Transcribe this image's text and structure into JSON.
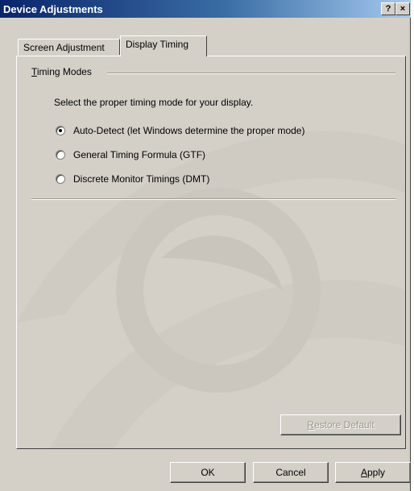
{
  "window": {
    "title": "Device Adjustments",
    "help_glyph": "?",
    "close_glyph": "×"
  },
  "tabs": [
    {
      "label": "Screen Adjustment",
      "active": false
    },
    {
      "label": "Display Timing",
      "active": true
    }
  ],
  "timing_group": {
    "label_mnemonic": "T",
    "label_rest": "iming Modes",
    "instruction": "Select the proper timing mode for your display.",
    "options": [
      {
        "label": "Auto-Detect (let Windows determine the proper mode)",
        "selected": true
      },
      {
        "label": "General Timing Formula (GTF)",
        "selected": false
      },
      {
        "label": "Discrete Monitor Timings (DMT)",
        "selected": false
      }
    ]
  },
  "buttons": {
    "restore_mnemonic": "R",
    "restore_rest": "estore Default",
    "ok": "OK",
    "cancel": "Cancel",
    "apply_mnemonic": "A",
    "apply_rest": "pply"
  },
  "colors": {
    "titlebar_start": "#0a246a",
    "titlebar_end": "#a6caf0",
    "face": "#d4d0c8"
  }
}
